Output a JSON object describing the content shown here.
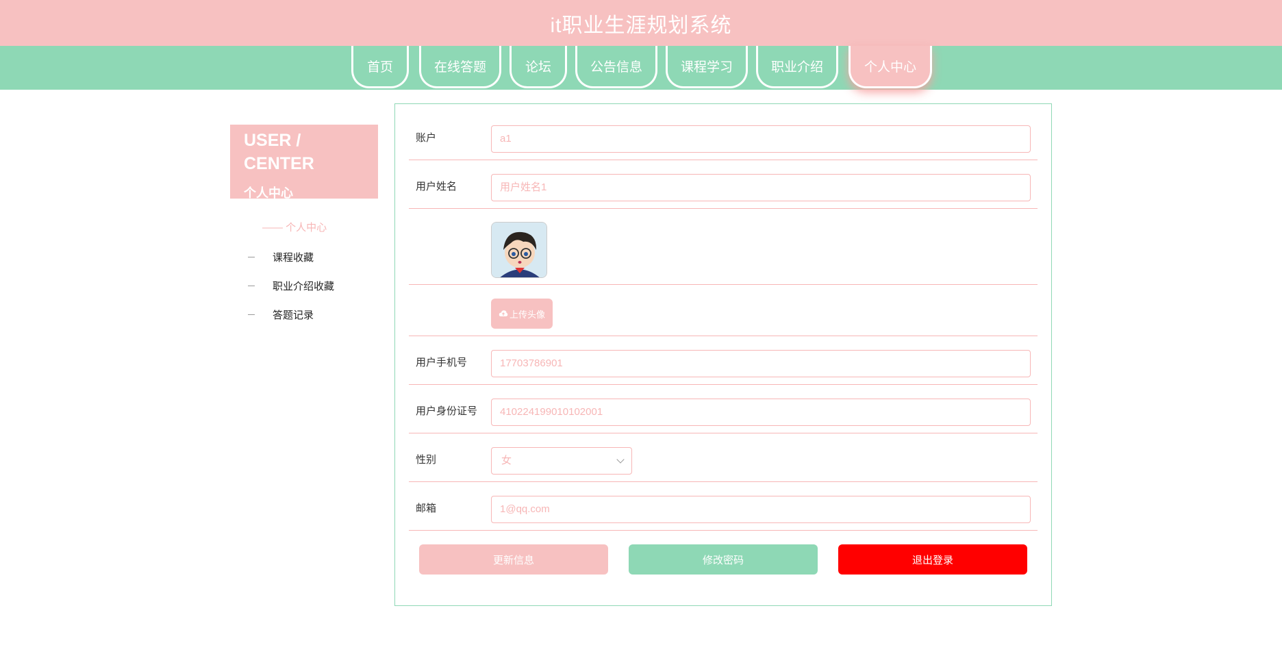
{
  "header": {
    "title": "it职业生涯规划系统"
  },
  "nav": {
    "items": [
      "首页",
      "在线答题",
      "论坛",
      "公告信息",
      "课程学习",
      "职业介绍",
      "个人中心"
    ],
    "active_index": 6
  },
  "sidebar": {
    "card_title_en": "USER / CENTER",
    "card_title_cn": "个人中心",
    "active_item": "—— 个人中心",
    "links": [
      "课程收藏",
      "职业介绍收藏",
      "答题记录"
    ]
  },
  "form": {
    "account": {
      "label": "账户",
      "value": "a1"
    },
    "username": {
      "label": "用户姓名",
      "value": "用户姓名1"
    },
    "upload_label": "上传头像",
    "phone": {
      "label": "用户手机号",
      "value": "17703786901"
    },
    "id_card": {
      "label": "用户身份证号",
      "value": "410224199010102001"
    },
    "gender": {
      "label": "性别",
      "value": "女"
    },
    "email": {
      "label": "邮箱",
      "value": "1@qq.com"
    }
  },
  "actions": {
    "update": "更新信息",
    "change_password": "修改密码",
    "logout": "退出登录"
  },
  "colors": {
    "pink": "#f7c1c1",
    "green": "#8ed8b5",
    "red": "#ff0000"
  }
}
